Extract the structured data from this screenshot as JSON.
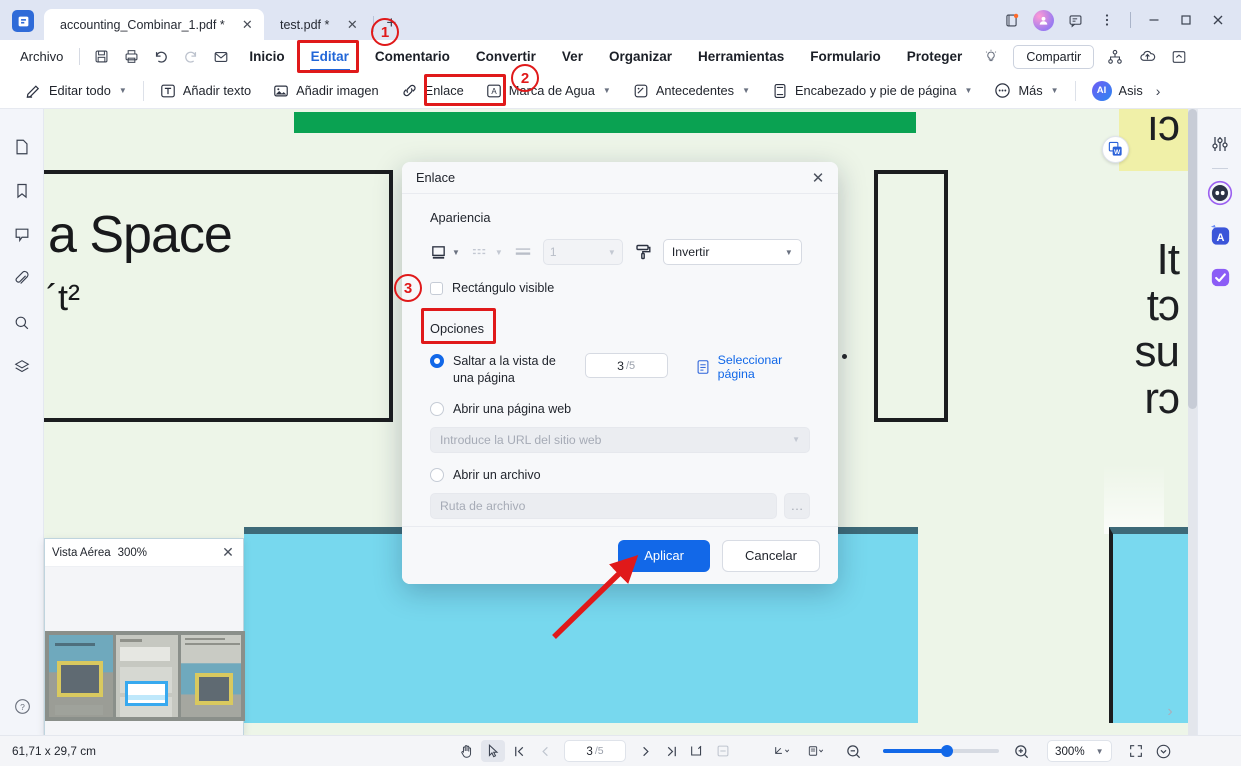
{
  "window": {
    "tabs": [
      {
        "label": "accounting_Combinar_1.pdf *",
        "active": true
      },
      {
        "label": "test.pdf *",
        "active": false
      }
    ],
    "new_tab_label": "+",
    "controls": {
      "minimize": "–",
      "maximize": "☐",
      "close": "✕"
    }
  },
  "menubar": {
    "archivo": "Archivo",
    "items": [
      {
        "label": "Inicio",
        "active": false
      },
      {
        "label": "Editar",
        "active": true
      },
      {
        "label": "Comentario",
        "active": false
      },
      {
        "label": "Convertir",
        "active": false
      },
      {
        "label": "Ver",
        "active": false
      },
      {
        "label": "Organizar",
        "active": false
      },
      {
        "label": "Herramientas",
        "active": false
      },
      {
        "label": "Formulario",
        "active": false
      },
      {
        "label": "Proteger",
        "active": false
      }
    ],
    "share_label": "Compartir"
  },
  "ribbon": {
    "items": [
      {
        "label": "Editar todo",
        "icon": "pencil-icon",
        "caret": true
      },
      {
        "label": "Añadir texto",
        "icon": "text-icon",
        "caret": false
      },
      {
        "label": "Añadir imagen",
        "icon": "image-icon",
        "caret": false
      },
      {
        "label": "Enlace",
        "icon": "link-icon",
        "caret": false
      },
      {
        "label": "Marca de Agua",
        "icon": "watermark-icon",
        "caret": true
      },
      {
        "label": "Antecedentes",
        "icon": "background-icon",
        "caret": true
      },
      {
        "label": "Encabezado y pie de página",
        "icon": "header-footer-icon",
        "caret": true
      },
      {
        "label": "Más",
        "icon": "more-dots-icon",
        "caret": true
      }
    ],
    "assistant_label": "Asis",
    "assistant_badge": "AI"
  },
  "left_rail": {
    "icons": [
      "page-icon",
      "bookmark-icon",
      "comment-icon",
      "attachment-icon",
      "search-icon",
      "layers-icon"
    ],
    "help_icon": "help-icon",
    "collapse_icon": "chevron-left-icon"
  },
  "right_rail": {
    "icons": [
      "sliders-icon",
      "robot-icon",
      "translate-icon",
      "checkmark-icon"
    ]
  },
  "document": {
    "heading": "a Space",
    "subheading": "´t²",
    "right_lines": [
      "ıɔ",
      "It",
      "tɔ",
      "su",
      "rɔ"
    ],
    "word_badge_icon": "word-export-icon"
  },
  "aerial_panel": {
    "title": "Vista Aérea",
    "zoom": "300%",
    "close_icon": "close-icon"
  },
  "dialog": {
    "title": "Enlace",
    "close_icon": "close-icon",
    "appearance_label": "Apariencia",
    "appearance": {
      "style_icon": "border-style-icon",
      "dash_icon": "dash-style-icon",
      "thickness_icon": "line-thickness-icon",
      "width_value": "1",
      "highlight_icon": "paint-roller-icon",
      "highlight_value": "Invertir"
    },
    "visible_rect_label": "Rectángulo visible",
    "visible_rect_checked": false,
    "options_label": "Opciones",
    "options": [
      {
        "label": "Saltar a la vista de una página",
        "selected": true,
        "page_value": "3",
        "page_total": "/5",
        "select_page_link": "Seleccionar página",
        "select_page_icon": "page-select-icon"
      },
      {
        "label": "Abrir una página web",
        "selected": false,
        "input_placeholder": "Introduce la URL del sitio web"
      },
      {
        "label": "Abrir un archivo",
        "selected": false,
        "input_placeholder": "Ruta de archivo",
        "browse_label": "…"
      }
    ],
    "apply_label": "Aplicar",
    "cancel_label": "Cancelar"
  },
  "annotations": {
    "badge_1": "1",
    "badge_2": "2",
    "badge_3": "3",
    "accent_color": "#e0191a"
  },
  "statusbar": {
    "dimensions": "61,71 x 29,7 cm",
    "hand_icon": "hand-icon",
    "select_icon": "select-cursor-icon",
    "first_page_icon": "first-page-icon",
    "prev_page_icon": "prev-page-icon",
    "page_value": "3",
    "page_total": "/5",
    "next_page_icon": "next-page-icon",
    "last_page_icon": "last-page-icon",
    "fit_icon": "fit-page-icon",
    "fit2_icon": "fit-width-icon",
    "pointer_icon": "pointer-mode-icon",
    "layout_icon": "page-layout-icon",
    "zoom_out_icon": "zoom-out-icon",
    "zoom_in_icon": "zoom-in-icon",
    "zoom_value": "300%",
    "fullscreen_icon": "fullscreen-icon",
    "more_icon": "more-circle-icon"
  },
  "colors": {
    "accent_blue": "#1268e8",
    "annotation_red": "#e0191a",
    "doc_green_band": "#0aa252",
    "doc_background": "#edf5e8",
    "cyan_block": "#77d8ee",
    "highlight_yellow": "#f0f0a8"
  }
}
